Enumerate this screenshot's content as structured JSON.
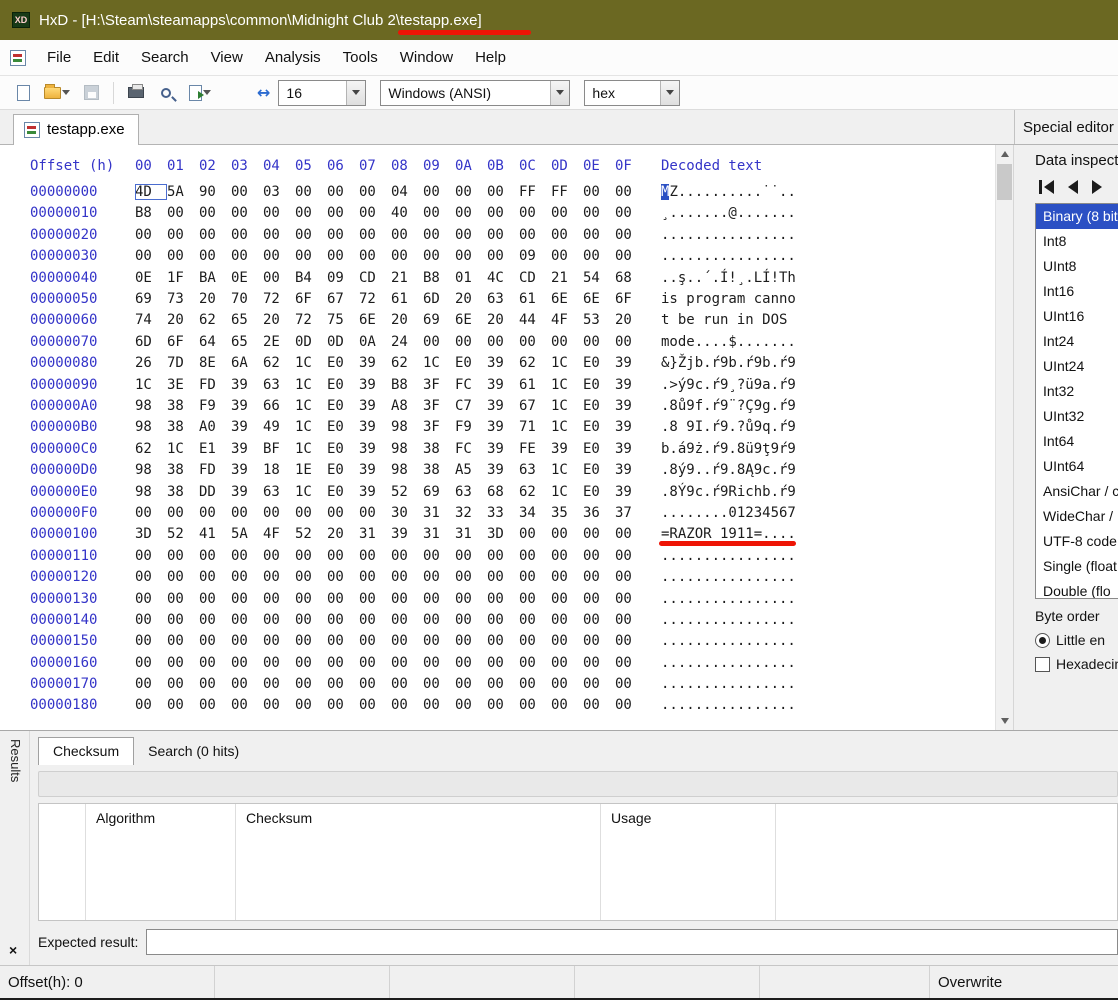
{
  "window": {
    "title_prefix": "HxD - [H:\\Steam\\steamapps\\common\\Midnight Club 2\\",
    "title_file": "testapp.exe",
    "title_suffix": "]"
  },
  "menu": {
    "items": [
      "File",
      "Edit",
      "Search",
      "View",
      "Analysis",
      "Tools",
      "Window",
      "Help"
    ]
  },
  "toolbar": {
    "bytes_per_row": "16",
    "encoding": "Windows (ANSI)",
    "offset_base": "hex"
  },
  "tabstrip": {
    "file_tab": "testapp.exe",
    "special_editor_label": "Special editor"
  },
  "hex": {
    "offset_header": "Offset (h)",
    "byte_headers": [
      "00",
      "01",
      "02",
      "03",
      "04",
      "05",
      "06",
      "07",
      "08",
      "09",
      "0A",
      "0B",
      "0C",
      "0D",
      "0E",
      "0F"
    ],
    "decoded_header": "Decoded text",
    "rows": [
      {
        "offset": "00000000",
        "bytes": [
          "4D",
          "5A",
          "90",
          "00",
          "03",
          "00",
          "00",
          "00",
          "04",
          "00",
          "00",
          "00",
          "FF",
          "FF",
          "00",
          "00"
        ],
        "decoded": "MZ..........˙˙..",
        "caret": true
      },
      {
        "offset": "00000010",
        "bytes": [
          "B8",
          "00",
          "00",
          "00",
          "00",
          "00",
          "00",
          "00",
          "40",
          "00",
          "00",
          "00",
          "00",
          "00",
          "00",
          "00"
        ],
        "decoded": "¸.......@......."
      },
      {
        "offset": "00000020",
        "bytes": [
          "00",
          "00",
          "00",
          "00",
          "00",
          "00",
          "00",
          "00",
          "00",
          "00",
          "00",
          "00",
          "00",
          "00",
          "00",
          "00"
        ],
        "decoded": "................"
      },
      {
        "offset": "00000030",
        "bytes": [
          "00",
          "00",
          "00",
          "00",
          "00",
          "00",
          "00",
          "00",
          "00",
          "00",
          "00",
          "00",
          "09",
          "00",
          "00",
          "00"
        ],
        "decoded": "................"
      },
      {
        "offset": "00000040",
        "bytes": [
          "0E",
          "1F",
          "BA",
          "0E",
          "00",
          "B4",
          "09",
          "CD",
          "21",
          "B8",
          "01",
          "4C",
          "CD",
          "21",
          "54",
          "68"
        ],
        "decoded": "..ş..´.Í!¸.LÍ!Th"
      },
      {
        "offset": "00000050",
        "bytes": [
          "69",
          "73",
          "20",
          "70",
          "72",
          "6F",
          "67",
          "72",
          "61",
          "6D",
          "20",
          "63",
          "61",
          "6E",
          "6E",
          "6F"
        ],
        "decoded": "is program canno"
      },
      {
        "offset": "00000060",
        "bytes": [
          "74",
          "20",
          "62",
          "65",
          "20",
          "72",
          "75",
          "6E",
          "20",
          "69",
          "6E",
          "20",
          "44",
          "4F",
          "53",
          "20"
        ],
        "decoded": "t be run in DOS "
      },
      {
        "offset": "00000070",
        "bytes": [
          "6D",
          "6F",
          "64",
          "65",
          "2E",
          "0D",
          "0D",
          "0A",
          "24",
          "00",
          "00",
          "00",
          "00",
          "00",
          "00",
          "00"
        ],
        "decoded": "mode....$......."
      },
      {
        "offset": "00000080",
        "bytes": [
          "26",
          "7D",
          "8E",
          "6A",
          "62",
          "1C",
          "E0",
          "39",
          "62",
          "1C",
          "E0",
          "39",
          "62",
          "1C",
          "E0",
          "39"
        ],
        "decoded": "&}Žjb.ŕ9b.ŕ9b.ŕ9"
      },
      {
        "offset": "00000090",
        "bytes": [
          "1C",
          "3E",
          "FD",
          "39",
          "63",
          "1C",
          "E0",
          "39",
          "B8",
          "3F",
          "FC",
          "39",
          "61",
          "1C",
          "E0",
          "39"
        ],
        "decoded": ".>ý9c.ŕ9¸?ü9a.ŕ9"
      },
      {
        "offset": "000000A0",
        "bytes": [
          "98",
          "38",
          "F9",
          "39",
          "66",
          "1C",
          "E0",
          "39",
          "A8",
          "3F",
          "C7",
          "39",
          "67",
          "1C",
          "E0",
          "39"
        ],
        "decoded": ".8ů9f.ŕ9¨?Ç9g.ŕ9"
      },
      {
        "offset": "000000B0",
        "bytes": [
          "98",
          "38",
          "A0",
          "39",
          "49",
          "1C",
          "E0",
          "39",
          "98",
          "3F",
          "F9",
          "39",
          "71",
          "1C",
          "E0",
          "39"
        ],
        "decoded": ".8 9I.ŕ9.?ů9q.ŕ9"
      },
      {
        "offset": "000000C0",
        "bytes": [
          "62",
          "1C",
          "E1",
          "39",
          "BF",
          "1C",
          "E0",
          "39",
          "98",
          "38",
          "FC",
          "39",
          "FE",
          "39",
          "E0",
          "39"
        ],
        "decoded": "b.á9ż.ŕ9.8ü9ţ9ŕ9"
      },
      {
        "offset": "000000D0",
        "bytes": [
          "98",
          "38",
          "FD",
          "39",
          "18",
          "1E",
          "E0",
          "39",
          "98",
          "38",
          "A5",
          "39",
          "63",
          "1C",
          "E0",
          "39"
        ],
        "decoded": ".8ý9..ŕ9.8Ą9c.ŕ9"
      },
      {
        "offset": "000000E0",
        "bytes": [
          "98",
          "38",
          "DD",
          "39",
          "63",
          "1C",
          "E0",
          "39",
          "52",
          "69",
          "63",
          "68",
          "62",
          "1C",
          "E0",
          "39"
        ],
        "decoded": ".8Ý9c.ŕ9Richb.ŕ9"
      },
      {
        "offset": "000000F0",
        "bytes": [
          "00",
          "00",
          "00",
          "00",
          "00",
          "00",
          "00",
          "00",
          "30",
          "31",
          "32",
          "33",
          "34",
          "35",
          "36",
          "37"
        ],
        "decoded": "........01234567"
      },
      {
        "offset": "00000100",
        "bytes": [
          "3D",
          "52",
          "41",
          "5A",
          "4F",
          "52",
          "20",
          "31",
          "39",
          "31",
          "31",
          "3D",
          "00",
          "00",
          "00",
          "00"
        ],
        "decoded": "=RAZOR 1911=....",
        "annotated": true
      },
      {
        "offset": "00000110",
        "bytes": [
          "00",
          "00",
          "00",
          "00",
          "00",
          "00",
          "00",
          "00",
          "00",
          "00",
          "00",
          "00",
          "00",
          "00",
          "00",
          "00"
        ],
        "decoded": "................"
      },
      {
        "offset": "00000120",
        "bytes": [
          "00",
          "00",
          "00",
          "00",
          "00",
          "00",
          "00",
          "00",
          "00",
          "00",
          "00",
          "00",
          "00",
          "00",
          "00",
          "00"
        ],
        "decoded": "................"
      },
      {
        "offset": "00000130",
        "bytes": [
          "00",
          "00",
          "00",
          "00",
          "00",
          "00",
          "00",
          "00",
          "00",
          "00",
          "00",
          "00",
          "00",
          "00",
          "00",
          "00"
        ],
        "decoded": "................"
      },
      {
        "offset": "00000140",
        "bytes": [
          "00",
          "00",
          "00",
          "00",
          "00",
          "00",
          "00",
          "00",
          "00",
          "00",
          "00",
          "00",
          "00",
          "00",
          "00",
          "00"
        ],
        "decoded": "................"
      },
      {
        "offset": "00000150",
        "bytes": [
          "00",
          "00",
          "00",
          "00",
          "00",
          "00",
          "00",
          "00",
          "00",
          "00",
          "00",
          "00",
          "00",
          "00",
          "00",
          "00"
        ],
        "decoded": "................"
      },
      {
        "offset": "00000160",
        "bytes": [
          "00",
          "00",
          "00",
          "00",
          "00",
          "00",
          "00",
          "00",
          "00",
          "00",
          "00",
          "00",
          "00",
          "00",
          "00",
          "00"
        ],
        "decoded": "................"
      },
      {
        "offset": "00000170",
        "bytes": [
          "00",
          "00",
          "00",
          "00",
          "00",
          "00",
          "00",
          "00",
          "00",
          "00",
          "00",
          "00",
          "00",
          "00",
          "00",
          "00"
        ],
        "decoded": "................"
      },
      {
        "offset": "00000180",
        "bytes": [
          "00",
          "00",
          "00",
          "00",
          "00",
          "00",
          "00",
          "00",
          "00",
          "00",
          "00",
          "00",
          "00",
          "00",
          "00",
          "00"
        ],
        "decoded": "................"
      }
    ]
  },
  "inspector": {
    "title": "Data inspecte",
    "items": [
      {
        "label": "Binary (8 bit",
        "selected": true
      },
      {
        "label": "Int8"
      },
      {
        "label": "UInt8"
      },
      {
        "label": "Int16"
      },
      {
        "label": "UInt16"
      },
      {
        "label": "Int24"
      },
      {
        "label": "UInt24"
      },
      {
        "label": "Int32"
      },
      {
        "label": "UInt32"
      },
      {
        "label": "Int64"
      },
      {
        "label": "UInt64"
      },
      {
        "label": "AnsiChar / c"
      },
      {
        "label": "WideChar / "
      },
      {
        "label": "UTF-8 code"
      },
      {
        "label": "Single (float"
      },
      {
        "label": "Double (flo"
      }
    ],
    "byte_order_label": "Byte order",
    "little_endian_label": "Little en",
    "hexadecimal_label": "Hexadecim"
  },
  "results_panel": {
    "rail_label": "Results",
    "close_glyph": "×",
    "tabs": [
      {
        "label": "Checksum",
        "active": true
      },
      {
        "label": "Search (0 hits)",
        "active": false
      }
    ],
    "table_headers": [
      "Algorithm",
      "Checksum",
      "Usage"
    ],
    "expected_result_label": "Expected result:"
  },
  "statusbar": {
    "offset_text": "Offset(h): 0",
    "mode_text": "Overwrite"
  },
  "colors": {
    "titlebar": "#6b6822",
    "annotation_red": "#ee1405",
    "header_blue": "#3434c8",
    "selection_blue": "#2b50c4"
  }
}
